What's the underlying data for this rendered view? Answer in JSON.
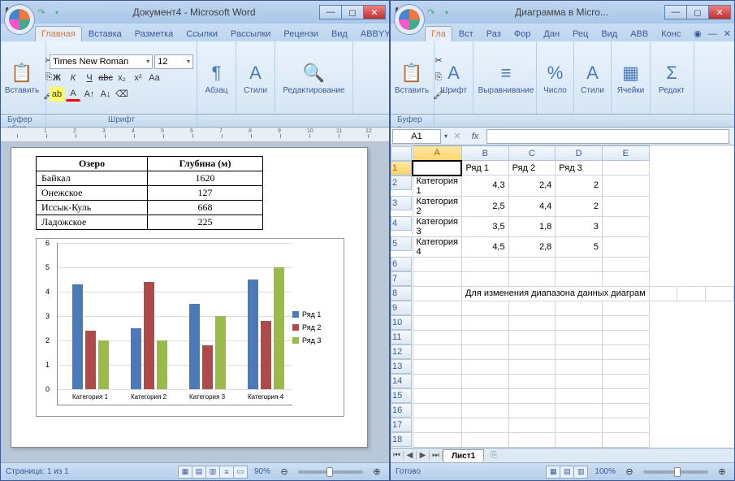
{
  "word": {
    "title": "Документ4 - Microsoft Word",
    "tabs": [
      "Главная",
      "Вставка",
      "Разметка",
      "Ссылки",
      "Рассылки",
      "Рецензи",
      "Вид",
      "ABBYY PD"
    ],
    "groups": {
      "clipboard": "Буфер обме...",
      "font": "Шрифт",
      "paragraph": "Абзац",
      "styles": "Стили",
      "editing": "Редактирование",
      "paste": "Вставить"
    },
    "font": {
      "name": "Times New Roman",
      "size": "12"
    },
    "status": {
      "page": "Страница: 1 из 1",
      "zoom": "90%"
    },
    "table": {
      "headers": [
        "Озеро",
        "Глубина (м)"
      ],
      "rows": [
        [
          "Байкал",
          "1620"
        ],
        [
          "Онежское",
          "127"
        ],
        [
          "Иссык-Куль",
          "668"
        ],
        [
          "Ладожское",
          "225"
        ]
      ]
    }
  },
  "excel": {
    "title": "Диаграмма в Micro...",
    "tabs": [
      "Гла",
      "Вст",
      "Раз",
      "Фор",
      "Дан",
      "Рец",
      "Вид",
      "ABB",
      "Конс"
    ],
    "groups": {
      "clipboard": "Буфер о...",
      "font": "Шрифт",
      "align": "Выравнивание",
      "number": "Число",
      "styles": "Стили",
      "cells": "Ячейки",
      "editing": "Редакт",
      "paste": "Вставить"
    },
    "name_box": "A1",
    "status": {
      "ready": "Готово",
      "zoom": "100%"
    },
    "sheet_tab": "Лист1",
    "columns": [
      "A",
      "B",
      "C",
      "D",
      "E"
    ],
    "note": "Для изменения диапазона данных диаграм",
    "grid": {
      "1": {
        "B": "Ряд 1",
        "C": "Ряд 2",
        "D": "Ряд 3"
      },
      "2": {
        "A": "Категория 1",
        "B": "4,3",
        "C": "2,4",
        "D": "2"
      },
      "3": {
        "A": "Категория 2",
        "B": "2,5",
        "C": "4,4",
        "D": "2"
      },
      "4": {
        "A": "Категория 3",
        "B": "3,5",
        "C": "1,8",
        "D": "3"
      },
      "5": {
        "A": "Категория 4",
        "B": "4,5",
        "C": "2,8",
        "D": "5"
      }
    }
  },
  "chart_data": {
    "type": "bar",
    "categories": [
      "Категория 1",
      "Категория 2",
      "Категория 3",
      "Категория 4"
    ],
    "series": [
      {
        "name": "Ряд 1",
        "values": [
          4.3,
          2.5,
          3.5,
          4.5
        ],
        "color": "#4a7ab8"
      },
      {
        "name": "Ряд 2",
        "values": [
          2.4,
          4.4,
          1.8,
          2.8
        ],
        "color": "#b04a4a"
      },
      {
        "name": "Ряд 3",
        "values": [
          2,
          2,
          3,
          5
        ],
        "color": "#9aba4a"
      }
    ],
    "ylim": [
      0,
      6
    ],
    "yticks": [
      0,
      1,
      2,
      3,
      4,
      5,
      6
    ]
  }
}
